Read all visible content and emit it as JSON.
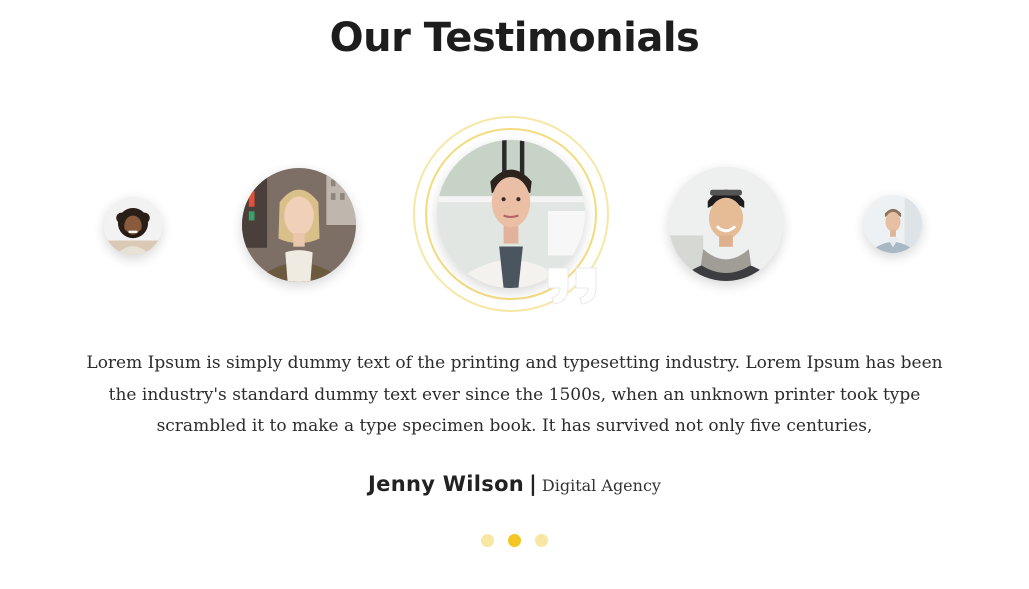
{
  "heading": {
    "prefix": "Our",
    "highlight": "Testimonials"
  },
  "avatars": [
    {
      "person": "man-curly-hair-beard",
      "active": false
    },
    {
      "person": "woman-blonde-scarf",
      "active": false
    },
    {
      "person": "woman-short-hair-white-jacket",
      "active": true
    },
    {
      "person": "man-glasses-on-head-scarf",
      "active": false
    },
    {
      "person": "man-short-hair-blue-shirt",
      "active": false
    }
  ],
  "testimonial": {
    "text": "Lorem Ipsum is simply dummy text of the printing and typesetting industry. Lorem Ipsum has been the industry's standard dummy text ever since the 1500s, when an unknown printer took  type scrambled it to make a type specimen book. It has survived not only five centuries,",
    "author_name": "Jenny Wilson",
    "separator": "|",
    "author_company": "Digital Agency"
  },
  "pagination": {
    "active_index": 1,
    "count": 3
  },
  "colors": {
    "accent": "#f3c623",
    "accent_light": "#f8e7a3",
    "heading": "#1d1d1d",
    "text": "#2c2c2c",
    "ring": "#f3dc80"
  },
  "icons": {
    "quote": "quote-icon"
  }
}
